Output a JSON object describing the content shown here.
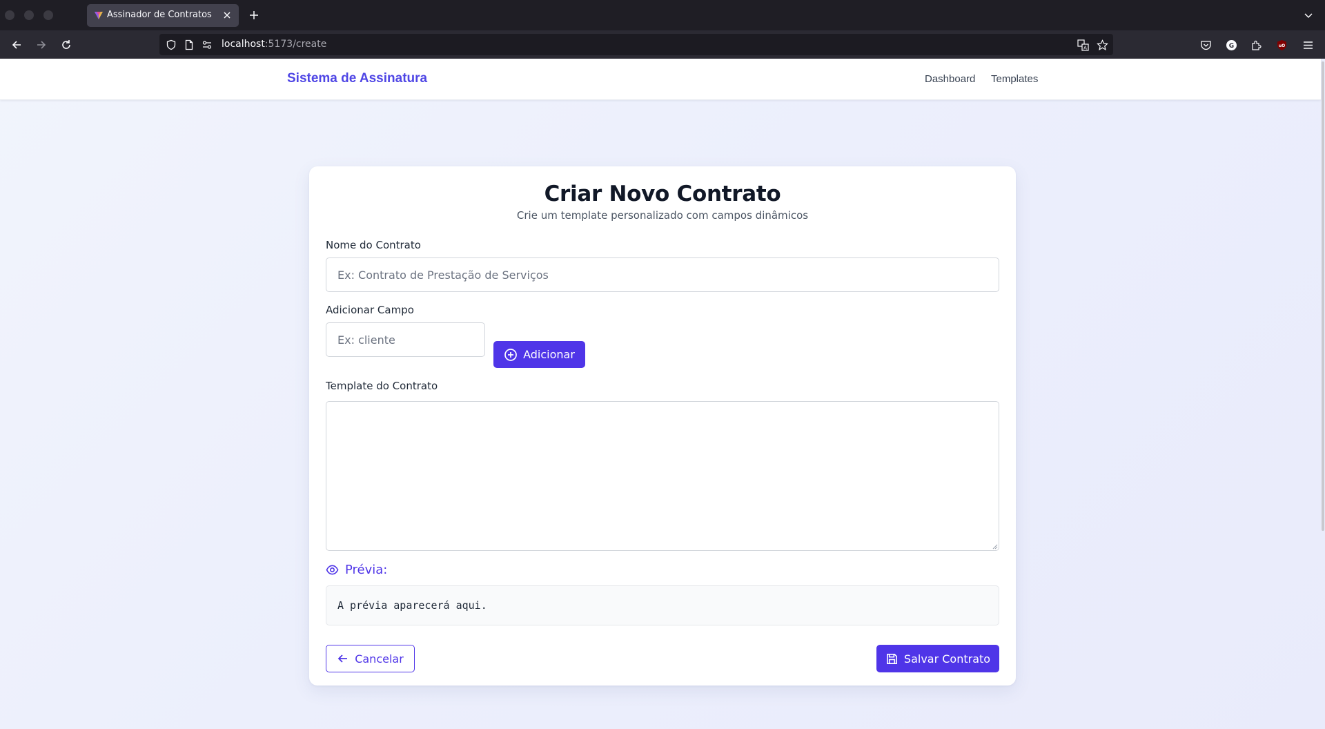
{
  "browser": {
    "tab_title": "Assinador de Contratos",
    "url_host": "localhost",
    "url_path": ":5173/create"
  },
  "site": {
    "brand": "Sistema de Assinatura",
    "nav": [
      {
        "label": "Dashboard"
      },
      {
        "label": "Templates"
      }
    ]
  },
  "form": {
    "title": "Criar Novo Contrato",
    "subtitle": "Crie um template personalizado com campos dinâmicos",
    "contract_name": {
      "label": "Nome do Contrato",
      "value": "",
      "placeholder": "Ex: Contrato de Prestação de Serviços"
    },
    "add_field": {
      "label": "Adicionar Campo",
      "value": "",
      "placeholder": "Ex: cliente",
      "button_label": "Adicionar"
    },
    "template": {
      "label": "Template do Contrato",
      "value": ""
    },
    "preview": {
      "label": "Prévia:",
      "text": "A prévia aparecerá aqui."
    },
    "cancel_label": "Cancelar",
    "save_label": "Salvar Contrato"
  },
  "colors": {
    "primary": "#4f35e8",
    "brand": "#4f46e5",
    "title": "#111827"
  }
}
